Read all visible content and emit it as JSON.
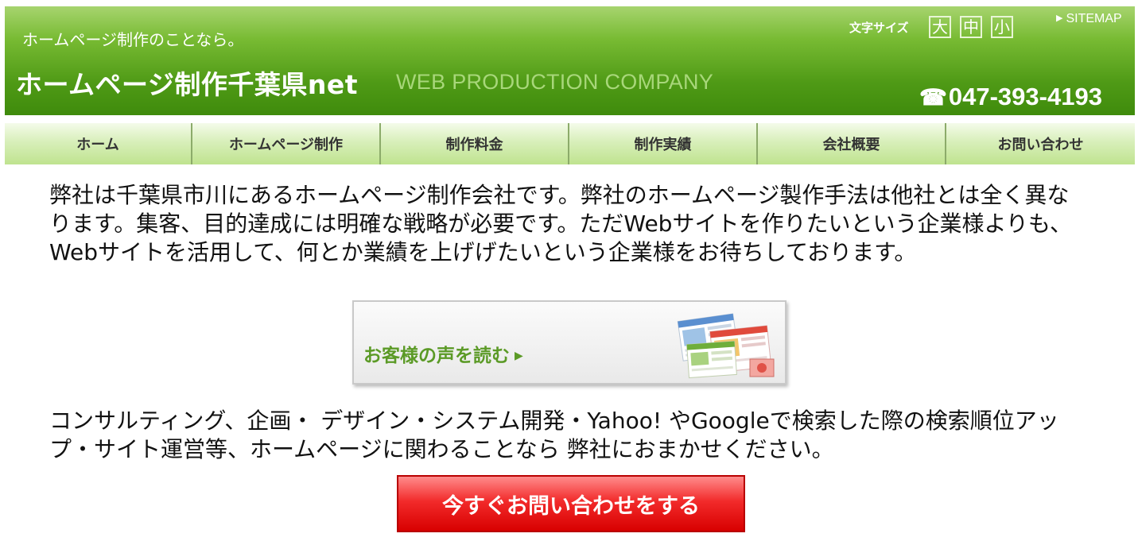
{
  "header": {
    "tagline": "ホームページ制作のことなら。",
    "title": "ホームページ制作千葉県net",
    "subtitle": "WEB PRODUCTION COMPANY",
    "font_size_label": "文字サイズ",
    "font_sizes": [
      "大",
      "中",
      "小"
    ],
    "sitemap_label": "SITEMAP",
    "phone": "047-393-4193"
  },
  "nav": {
    "items": [
      {
        "label": "ホーム"
      },
      {
        "label": "ホームページ制作"
      },
      {
        "label": "制作料金"
      },
      {
        "label": "制作実績"
      },
      {
        "label": "会社概要"
      },
      {
        "label": "お問い合わせ"
      }
    ]
  },
  "main": {
    "intro": "弊社は千葉県市川にあるホームページ制作会社です。弊社のホームページ製作手法は他社とは全く異なります。集客、目的達成には明確な戦略が必要です。ただWebサイトを作りたいという企業様よりも、Webサイトを活用して、何とか業績を上げげたいという企業様をお待ちしております。",
    "voice_banner_label": "お客様の声を読む",
    "services": "コンサルティング、企画・ デザイン・システム開発・Yahoo! やGoogleで検索した際の検索順位アップ・サイト運営等、ホームページに関わることなら 弊社におまかせください。",
    "cta_label": "今すぐお問い合わせをする"
  },
  "colors": {
    "header_green": "#4f9a16",
    "nav_light_green": "#d8efba",
    "banner_green_text": "#5b9a26",
    "cta_red": "#e01010"
  }
}
